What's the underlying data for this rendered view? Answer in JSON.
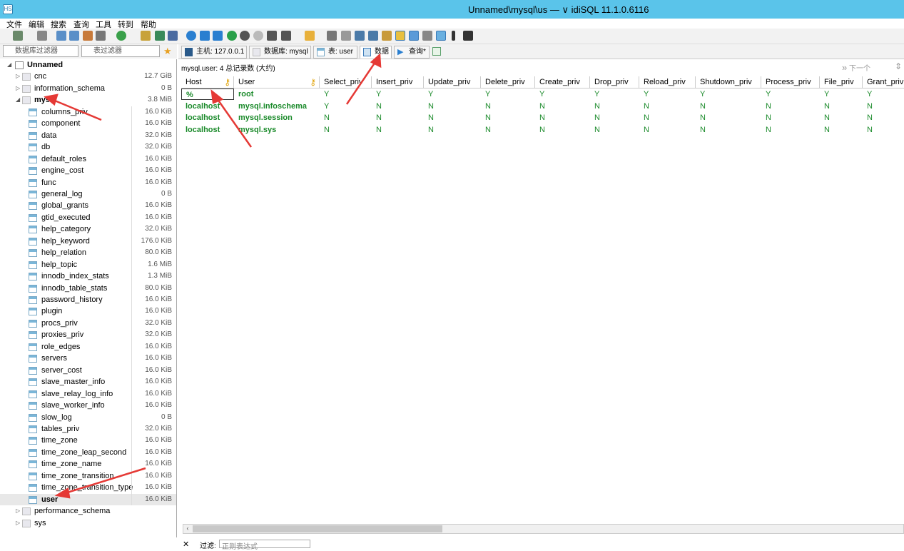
{
  "window": {
    "title": "Unnamed\\mysql\\us  —  ∨ idiSQL 11.1.0.6116",
    "logo": "HS"
  },
  "menu": [
    "文件",
    "编辑",
    "搜索",
    "查询",
    "工具",
    "转到",
    "帮助"
  ],
  "filters": {
    "db_filter": "数据库过滤器",
    "table_filter": "表过滤器"
  },
  "tabs": [
    {
      "label": "主机: 127.0.0.1",
      "icon": "server-icon"
    },
    {
      "label": "数据库: mysql",
      "icon": "database-icon"
    },
    {
      "label": "表: user",
      "icon": "table-icon"
    },
    {
      "label": "数据",
      "icon": "grid-icon",
      "active": true
    },
    {
      "label": "查询*",
      "icon": "play-icon"
    }
  ],
  "tree": {
    "root": "Unnamed",
    "databases": [
      {
        "name": "cnc",
        "size": "12.7 GiB"
      },
      {
        "name": "information_schema",
        "size": "0 B"
      },
      {
        "name": "mysql",
        "size": "3.8 MiB",
        "expanded": true
      }
    ],
    "tables": [
      {
        "name": "columns_priv",
        "size": "16.0 KiB"
      },
      {
        "name": "component",
        "size": "16.0 KiB"
      },
      {
        "name": "data",
        "size": "32.0 KiB"
      },
      {
        "name": "db",
        "size": "32.0 KiB"
      },
      {
        "name": "default_roles",
        "size": "16.0 KiB"
      },
      {
        "name": "engine_cost",
        "size": "16.0 KiB"
      },
      {
        "name": "func",
        "size": "16.0 KiB"
      },
      {
        "name": "general_log",
        "size": "0 B"
      },
      {
        "name": "global_grants",
        "size": "16.0 KiB"
      },
      {
        "name": "gtid_executed",
        "size": "16.0 KiB"
      },
      {
        "name": "help_category",
        "size": "32.0 KiB"
      },
      {
        "name": "help_keyword",
        "size": "176.0 KiB"
      },
      {
        "name": "help_relation",
        "size": "80.0 KiB"
      },
      {
        "name": "help_topic",
        "size": "1.6 MiB"
      },
      {
        "name": "innodb_index_stats",
        "size": "1.3 MiB"
      },
      {
        "name": "innodb_table_stats",
        "size": "80.0 KiB"
      },
      {
        "name": "password_history",
        "size": "16.0 KiB"
      },
      {
        "name": "plugin",
        "size": "16.0 KiB"
      },
      {
        "name": "procs_priv",
        "size": "32.0 KiB"
      },
      {
        "name": "proxies_priv",
        "size": "32.0 KiB"
      },
      {
        "name": "role_edges",
        "size": "16.0 KiB"
      },
      {
        "name": "servers",
        "size": "16.0 KiB"
      },
      {
        "name": "server_cost",
        "size": "16.0 KiB"
      },
      {
        "name": "slave_master_info",
        "size": "16.0 KiB"
      },
      {
        "name": "slave_relay_log_info",
        "size": "16.0 KiB"
      },
      {
        "name": "slave_worker_info",
        "size": "16.0 KiB"
      },
      {
        "name": "slow_log",
        "size": "0 B"
      },
      {
        "name": "tables_priv",
        "size": "32.0 KiB"
      },
      {
        "name": "time_zone",
        "size": "16.0 KiB"
      },
      {
        "name": "time_zone_leap_second",
        "size": "16.0 KiB"
      },
      {
        "name": "time_zone_name",
        "size": "16.0 KiB"
      },
      {
        "name": "time_zone_transition",
        "size": "16.0 KiB"
      },
      {
        "name": "time_zone_transition_type",
        "size": "16.0 KiB"
      },
      {
        "name": "user",
        "size": "16.0 KiB",
        "selected": true
      }
    ],
    "after": [
      {
        "name": "performance_schema"
      },
      {
        "name": "sys"
      }
    ]
  },
  "grid": {
    "header_text": "mysql.user: 4 总记录数 (大约)",
    "next_label": "下一个",
    "columns": [
      "Host",
      "User",
      "Select_priv",
      "Insert_priv",
      "Update_priv",
      "Delete_priv",
      "Create_priv",
      "Drop_priv",
      "Reload_priv",
      "Shutdown_priv",
      "Process_priv",
      "File_priv",
      "Grant_priv"
    ],
    "rows": [
      [
        "%",
        "root",
        "Y",
        "Y",
        "Y",
        "Y",
        "Y",
        "Y",
        "Y",
        "Y",
        "Y",
        "Y",
        "Y"
      ],
      [
        "localhost",
        "mysql.infoschema",
        "Y",
        "N",
        "N",
        "N",
        "N",
        "N",
        "N",
        "N",
        "N",
        "N",
        "N"
      ],
      [
        "localhost",
        "mysql.session",
        "N",
        "N",
        "N",
        "N",
        "N",
        "N",
        "N",
        "N",
        "N",
        "N",
        "N"
      ],
      [
        "localhost",
        "mysql.sys",
        "N",
        "N",
        "N",
        "N",
        "N",
        "N",
        "N",
        "N",
        "N",
        "N",
        "N"
      ]
    ]
  },
  "statusbar": {
    "filter_label": "过滤:",
    "filter_placeholder": "正则表达式"
  }
}
